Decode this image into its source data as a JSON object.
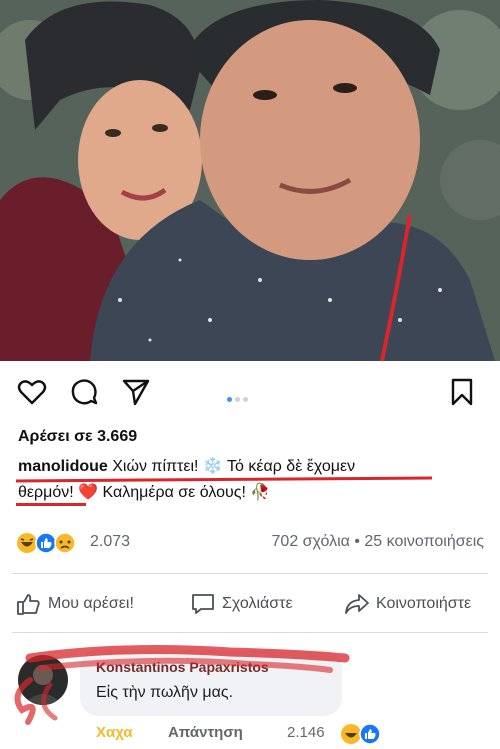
{
  "post": {
    "likes": "Αρέσει σε 3.669",
    "username": "manolidoue",
    "caption_line1": "Χιών πίπτει! ❄️ Τό κέαρ δὲ ἔχομεν",
    "caption_line2": "θερμόν! ❤️ Καλημέρα σε όλους! 🥀"
  },
  "reactions": {
    "icons": [
      "haha-emoji-icon",
      "like-icon",
      "sad-emoji-icon"
    ],
    "count": "2.073",
    "summary": "702 σχόλια • 25 κοινοποιήσεις"
  },
  "actions": {
    "like": "Μου αρέσει!",
    "comment": "Σχολιάστε",
    "share": "Κοινοποιήστε"
  },
  "comment": {
    "author": "Konstantinos Papaxristos",
    "text": "Εἰς τὴν πωλῆν μας.",
    "haha": "Χαχα",
    "reply": "Απάντηση",
    "reaction_count": "2.146"
  },
  "colors": {
    "accent_red": "#d8262b",
    "dot_active": "#3897f0",
    "haha_yellow": "#f7b928",
    "fb_blue": "#1877f2"
  }
}
